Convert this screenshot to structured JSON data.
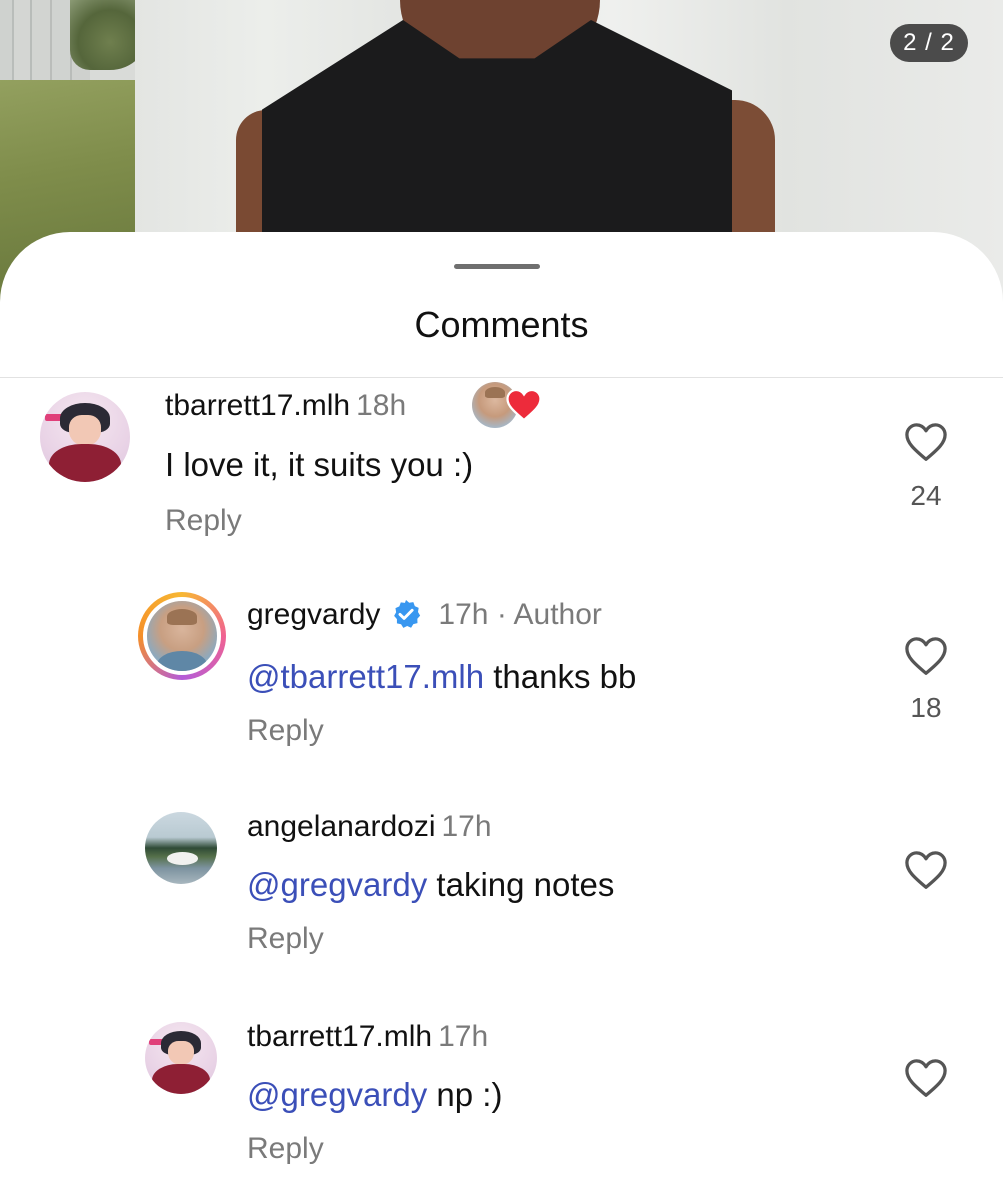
{
  "pager": {
    "label": "2 / 2"
  },
  "sheet": {
    "title": "Comments"
  },
  "comments": [
    {
      "username": "tbarrett17.mlh",
      "time": "18h",
      "mention": "",
      "text": "I love it, it suits you :)",
      "reply_label": "Reply",
      "likes": "24",
      "avatar_icon": "anime-avatar",
      "liked_by_author": true
    },
    {
      "username": "gregvardy",
      "verified": true,
      "time": "17h",
      "meta_separator": "·",
      "meta": "Author",
      "mention": "@tbarrett17.mlh",
      "text": " thanks bb",
      "reply_label": "Reply",
      "likes": "18",
      "avatar_icon": "author-photo-avatar"
    },
    {
      "username": "angelanardozi",
      "time": "17h",
      "mention": "@gregvardy",
      "text": " taking notes",
      "reply_label": "Reply",
      "likes": "",
      "avatar_icon": "lake-photo-avatar"
    },
    {
      "username": "tbarrett17.mlh",
      "time": "17h",
      "mention": "@gregvardy",
      "text": " np :)",
      "reply_label": "Reply",
      "likes": "",
      "avatar_icon": "anime-avatar"
    }
  ],
  "colors": {
    "mention": "#3b4fb8",
    "verified": "#3897f0",
    "heart_liked": "#ed2b3b",
    "muted_text": "#7a7a7a"
  }
}
